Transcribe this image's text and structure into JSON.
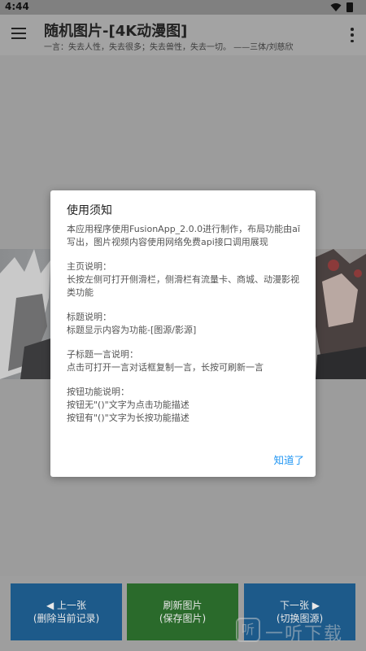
{
  "status_bar": {
    "time": "4:44",
    "wifi_icon": "wifi-icon",
    "battery_icon": "battery-icon"
  },
  "app_bar": {
    "menu_icon": "hamburger-menu-icon",
    "title": "随机图片-[4K动漫图]",
    "subtitle": "一言：失去人性，失去很多；失去兽性，失去一切。 ——三体/刘慈欣",
    "more_icon": "more-vertical-icon"
  },
  "dialog": {
    "title": "使用须知",
    "paragraphs": [
      {
        "lines": [
          "本应用程序使用FusionApp_2.0.0进行制作，布局功能由aī写出，图片视频内容使用网络免费api接口调用展现"
        ]
      },
      {
        "lines": [
          "主页说明：",
          "长按左侧可打开侧滑栏，侧滑栏有流量卡、商城、动漫影视类功能"
        ]
      },
      {
        "lines": [
          "标题说明：",
          "标题显示内容为功能-[图源/影源]"
        ]
      },
      {
        "lines": [
          "子标题一言说明：",
          "点击可打开一言对话框复制一言，长按可刷新一言"
        ]
      },
      {
        "lines": [
          "按钮功能说明：",
          "按钮无\"()\"文字为点击功能描述",
          "按钮有\"()\"文字为长按功能描述"
        ]
      }
    ],
    "ok_button": "知道了"
  },
  "buttons": {
    "prev": {
      "line1": "◀ 上一张",
      "line2": "(删除当前记录)"
    },
    "refresh": {
      "line1": "刷新图片",
      "line2": "(保存图片)"
    },
    "next": {
      "line1": "下一张 ▶",
      "line2": "(切换图源)"
    }
  },
  "watermark": {
    "text": "一听下载",
    "logo_glyph": "听"
  },
  "colors": {
    "button_blue": "#1d5a8a",
    "button_green": "#2a6a2b",
    "dialog_accent": "#2196f3"
  }
}
